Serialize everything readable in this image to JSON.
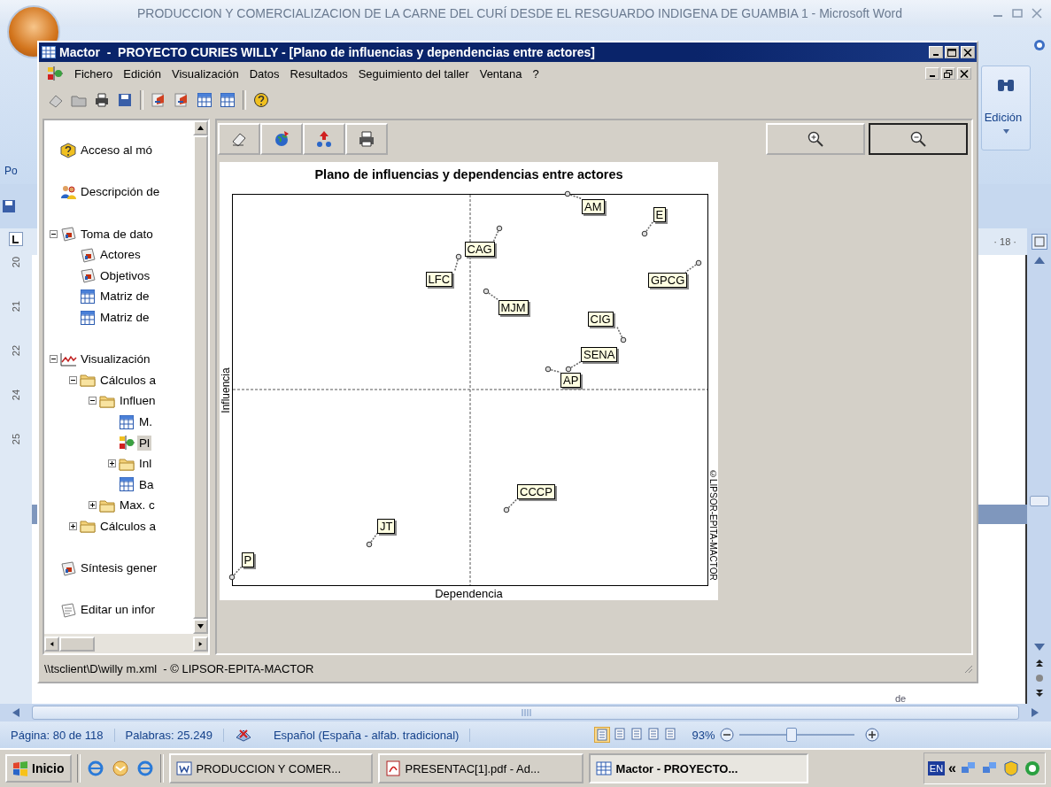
{
  "word": {
    "title": "PRODUCCION Y COMERCIALIZACION DE LA CARNE DEL CURÍ DESDE EL RESGUARDO INDIGENA DE GUAMBIA 1 - Microsoft Word",
    "ribbon_left_label": "Po",
    "ribbon_group": "Edición",
    "ruler_mark": "· 18 ·",
    "vertical_ruler": [
      "20",
      "21",
      "22",
      "24",
      "25"
    ],
    "page_text": "de",
    "status_bar": {
      "page": "Página: 80 de 118",
      "words": "Palabras: 25.249",
      "language": "Español (España - alfab. tradicional)",
      "zoom": "93%",
      "zoom_slider": {
        "level": 0.45
      }
    }
  },
  "mactor": {
    "title": "Mactor  -  PROYECTO CURIES WILLY - [Plano de influencias y dependencias entre actores]",
    "menu": [
      "Fichero",
      "Edición",
      "Visualización",
      "Datos",
      "Resultados",
      "Seguimiento del taller",
      "Ventana",
      "?"
    ],
    "tree": [
      {
        "label": "Acceso al mó",
        "kind": "help",
        "selected": false
      },
      {
        "label": "Descripción de",
        "kind": "people",
        "selected": false
      },
      {
        "label": "Toma de dato",
        "kind": "data",
        "selected": false,
        "expanded": true,
        "children": [
          {
            "label": "Actores",
            "kind": "data",
            "selected": false
          },
          {
            "label": "Objetivos",
            "kind": "data",
            "selected": false
          },
          {
            "label": "Matriz de",
            "kind": "matrix",
            "selected": false
          },
          {
            "label": "Matriz de",
            "kind": "matrix",
            "selected": false
          }
        ]
      },
      {
        "label": "Visualización",
        "kind": "graph",
        "selected": false,
        "expanded": true,
        "children": [
          {
            "label": "Cálculos a",
            "kind": "folder",
            "selected": false,
            "expanded": true,
            "children": [
              {
                "label": "Influen",
                "kind": "folder",
                "selected": false,
                "expanded": true,
                "children": [
                  {
                    "label": "M.",
                    "kind": "matrix",
                    "selected": false
                  },
                  {
                    "label": "Pl",
                    "kind": "plane",
                    "selected": true
                  },
                  {
                    "label": "Inl",
                    "kind": "folder",
                    "selected": false,
                    "expanded": false
                  },
                  {
                    "label": "Ba",
                    "kind": "matrix",
                    "selected": false
                  }
                ]
              },
              {
                "label": "Max. c",
                "kind": "folder",
                "selected": false,
                "expanded": false
              }
            ]
          },
          {
            "label": "Cálculos a",
            "kind": "folder",
            "selected": false,
            "expanded": false
          }
        ]
      },
      {
        "label": "Síntesis gener",
        "kind": "data",
        "selected": false
      },
      {
        "label": "Editar un infor",
        "kind": "report",
        "selected": false
      }
    ],
    "chart": {
      "title": "Plano de influencias y dependencias entre actores",
      "xlabel": "Dependencia",
      "ylabel": "Influencia",
      "copyright": "©LIPSOR-EPITA-MACTOR",
      "actors": [
        "AM",
        "E",
        "CAG",
        "LFC",
        "MJM",
        "GPCG",
        "CIG",
        "SENA",
        "AP",
        "CCCP",
        "JT",
        "P"
      ]
    },
    "status": "\\\\tsclient\\D\\willy m.xml  - © LIPSOR-EPITA-MACTOR"
  },
  "taskbar": {
    "start": "Inicio",
    "tasks": [
      {
        "label": "PRODUCCION Y COMER...",
        "kind": "word",
        "selected": false
      },
      {
        "label": "PRESENTAC[1].pdf - Ad...",
        "kind": "pdf",
        "selected": false
      },
      {
        "label": "Mactor  -  PROYECTO...",
        "kind": "mactor",
        "selected": true
      }
    ],
    "language": "EN",
    "tray_expand": "«"
  }
}
